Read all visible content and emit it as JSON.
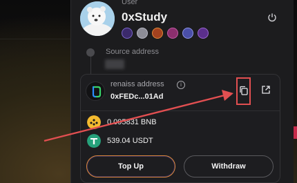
{
  "user": {
    "label": "User",
    "name": "0xStudy",
    "badges": [
      "badge-1",
      "badge-2",
      "badge-3",
      "badge-4",
      "badge-5",
      "badge-6"
    ]
  },
  "source": {
    "label": "Source address"
  },
  "renaiss": {
    "label": "renaiss address",
    "address": "0xFEDc...01Ad"
  },
  "tokens": [
    {
      "amount": "0.095831 BNB",
      "icon": "bnb-icon",
      "color": "#F3BA2F"
    },
    {
      "amount": "539.04 USDT",
      "icon": "usdt-icon",
      "color": "#26A17B"
    }
  ],
  "actions": {
    "topup": "Top Up",
    "withdraw": "Withdraw"
  },
  "colors": {
    "annotation": "#E24F51",
    "topup_border": "#E08A3B",
    "panel": "#1C1C1E"
  }
}
